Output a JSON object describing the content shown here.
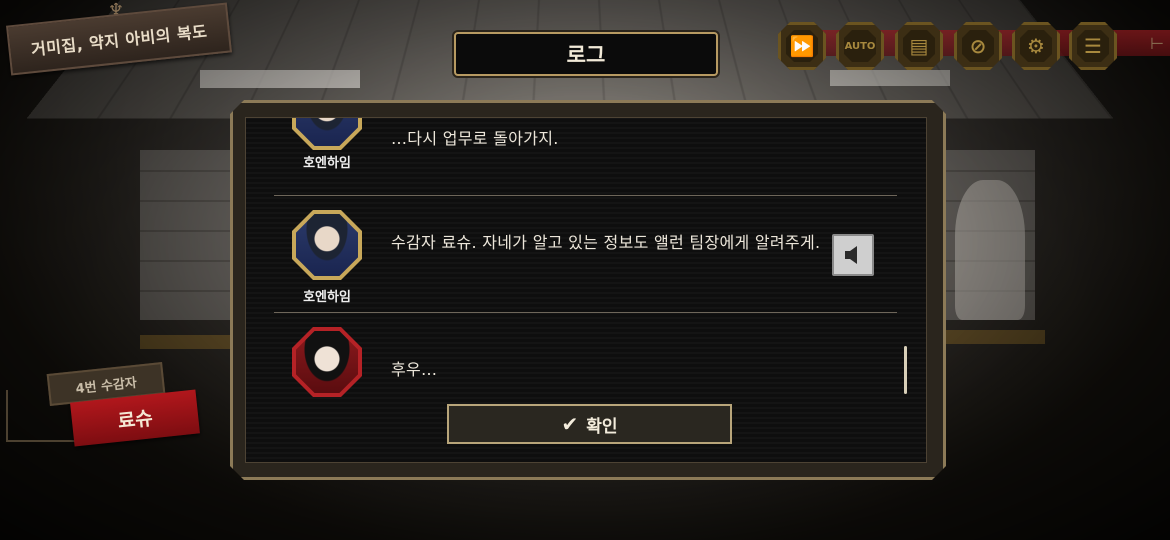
{
  "location": {
    "title": "거미집, 약지 아비의 복도"
  },
  "header": {
    "title": "로그"
  },
  "toolbar": {
    "buttons": [
      {
        "icon": "fast-forward-icon",
        "glyph": "⏩"
      },
      {
        "icon": "auto-icon",
        "glyph": "AUTO"
      },
      {
        "icon": "log-icon",
        "glyph": "▤"
      },
      {
        "icon": "hide-ui-icon",
        "glyph": "⊘"
      },
      {
        "icon": "settings-icon",
        "glyph": "⚙"
      },
      {
        "icon": "menu-icon",
        "glyph": "☰"
      }
    ]
  },
  "nameplate": {
    "subtitle": "4번 수감자",
    "name": "료슈"
  },
  "log": {
    "entries": [
      {
        "speaker": "호엔하임",
        "text": "…다시 업무로 돌아가지.",
        "has_voice": false
      },
      {
        "speaker": "호엔하임",
        "text": "수감자 료슈. 자네가 알고 있는 정보도 앨런 팀장에게 알려주게.",
        "has_voice": true
      },
      {
        "speaker": "",
        "text": "후우…",
        "has_voice": false
      }
    ],
    "confirm_label": "확인"
  },
  "colors": {
    "accent_gold": "#b8a57a",
    "red": "#b1171c"
  }
}
